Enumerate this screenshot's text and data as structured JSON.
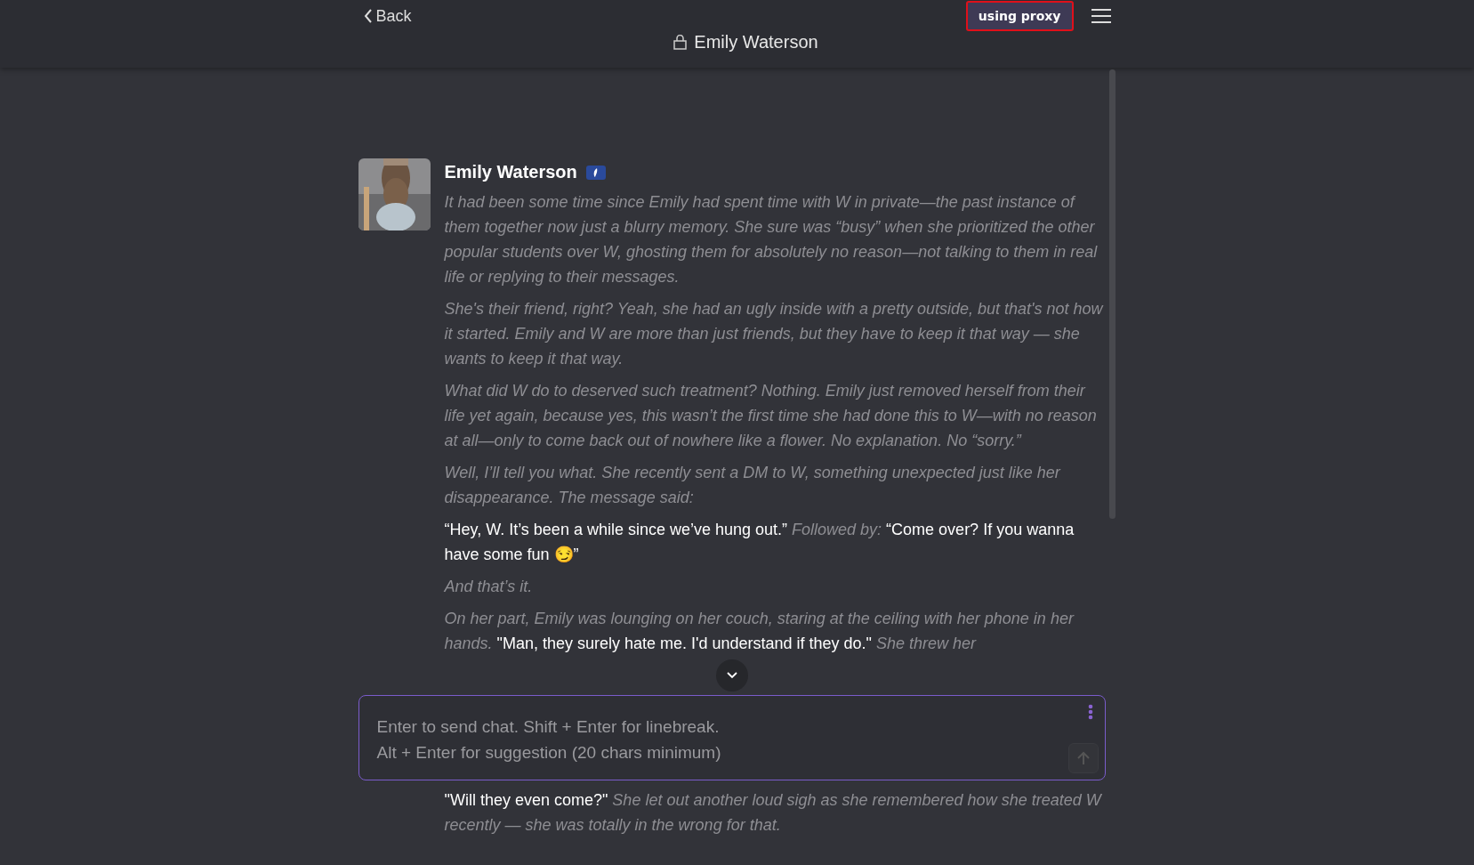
{
  "header": {
    "back": "Back",
    "proxy_button": "using proxy",
    "title": "Emily Waterson"
  },
  "message": {
    "author": "Emily Waterson",
    "paragraphs": [
      {
        "segments": [
          {
            "kind": "narration",
            "text": "It had been some time since Emily had spent time with W in private—the past instance of them together now just a blurry memory. She sure was “busy” when she prioritized the other popular students over W, ghosting them for absolutely no reason—not talking to them in real life or replying to their messages."
          }
        ]
      },
      {
        "segments": [
          {
            "kind": "narration",
            "text": "She's their friend, right? Yeah, she had an ugly inside with a pretty outside, but that's not how it started. Emily and W are more than just friends, but they have to keep it that way — she wants to keep it that way."
          }
        ]
      },
      {
        "segments": [
          {
            "kind": "narration",
            "text": "What did W do to deserved such treatment? Nothing. Emily just removed herself from their life yet again, because yes, this wasn’t the first time she had done this to W—with no reason at all—only to come back out of nowhere like a flower. No explanation. No “sorry.”"
          }
        ]
      },
      {
        "segments": [
          {
            "kind": "narration",
            "text": "Well, I’ll tell you what. She recently sent a DM to W, something unexpected just like her disappearance. The message said:"
          }
        ]
      },
      {
        "segments": [
          {
            "kind": "speech",
            "text": "“Hey, W. It’s been a while since we’ve hung out.”"
          },
          {
            "kind": "narration",
            "text": " Followed by: "
          },
          {
            "kind": "speech",
            "text": "“Come over? If you wanna have some fun 😏”"
          }
        ]
      },
      {
        "segments": [
          {
            "kind": "narration",
            "text": "And that’s it."
          }
        ]
      },
      {
        "segments": [
          {
            "kind": "narration",
            "text": "On her part, Emily was lounging on her couch, staring at the ceiling with her phone in her hands. "
          },
          {
            "kind": "speech",
            "text": "\"Man, they surely hate me. I'd understand if they do.\""
          },
          {
            "kind": "narration",
            "text": " She threw her"
          }
        ]
      }
    ],
    "after_input": {
      "segments": [
        {
          "kind": "speech",
          "text": "\"Will they even come?\""
        },
        {
          "kind": "narration",
          "text": " She let out another loud sigh as she remembered how she treated W recently — she was totally in the wrong for that."
        }
      ]
    }
  },
  "input": {
    "placeholder": "Enter to send chat. Shift + Enter for linebreak.\nAlt + Enter for suggestion (20 chars minimum)"
  }
}
